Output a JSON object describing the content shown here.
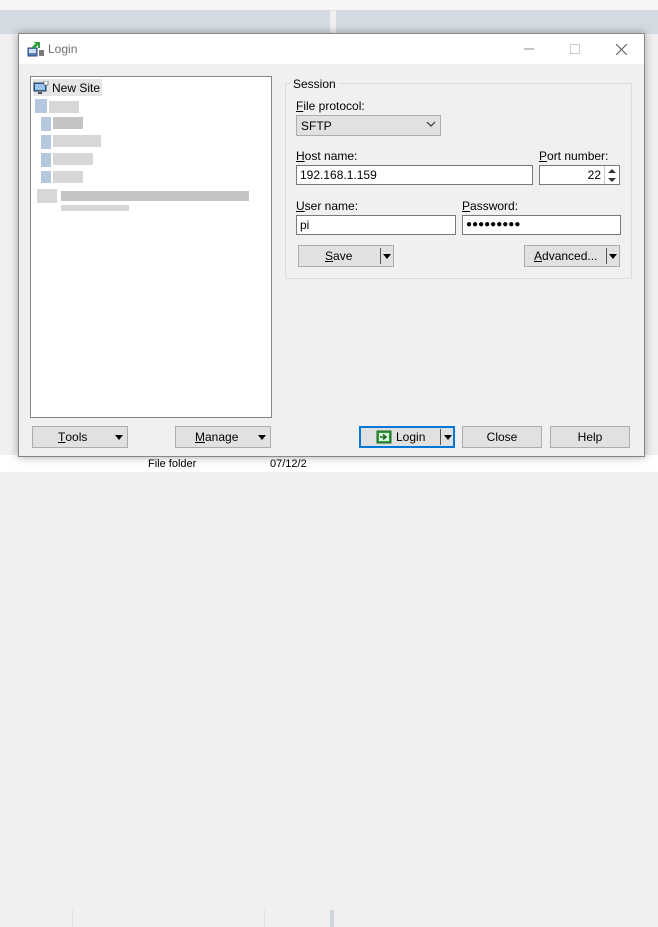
{
  "background": {
    "list_row_type": "File folder",
    "list_row_date": "07/12/2"
  },
  "dialog": {
    "title": "Login",
    "titlebar_icons": [
      "minimize-icon",
      "maximize-icon",
      "close-icon"
    ]
  },
  "site_tree": {
    "items": [
      {
        "label": "New Site",
        "icon": "new-site-icon",
        "selected": true
      }
    ]
  },
  "session": {
    "group_title": "Session",
    "file_protocol": {
      "label_underlined": "F",
      "label_rest": "ile protocol:",
      "value": "SFTP"
    },
    "host_name": {
      "label_underlined": "H",
      "label_rest": "ost name:",
      "value": "192.168.1.159"
    },
    "port_number": {
      "label_underlined": "P",
      "label_rest": "ort number:",
      "value": "22"
    },
    "user_name": {
      "label_underlined": "U",
      "label_rest": "ser name:",
      "value": "pi"
    },
    "password": {
      "label_underlined": "P",
      "label_rest": "assword:",
      "value": "●●●●●●●●●"
    },
    "save_button": {
      "underlined": "S",
      "rest": "ave"
    },
    "advanced_button": {
      "underlined": "A",
      "rest": "dvanced..."
    }
  },
  "footer": {
    "tools_button": {
      "underlined": "T",
      "rest": "ools"
    },
    "manage_button": {
      "underlined": "M",
      "rest": "anage"
    },
    "login_button": "Login",
    "close_button": "Close",
    "help_button": "Help"
  },
  "colors": {
    "accent": "#0078d7",
    "selection": "#e5e5e5"
  }
}
